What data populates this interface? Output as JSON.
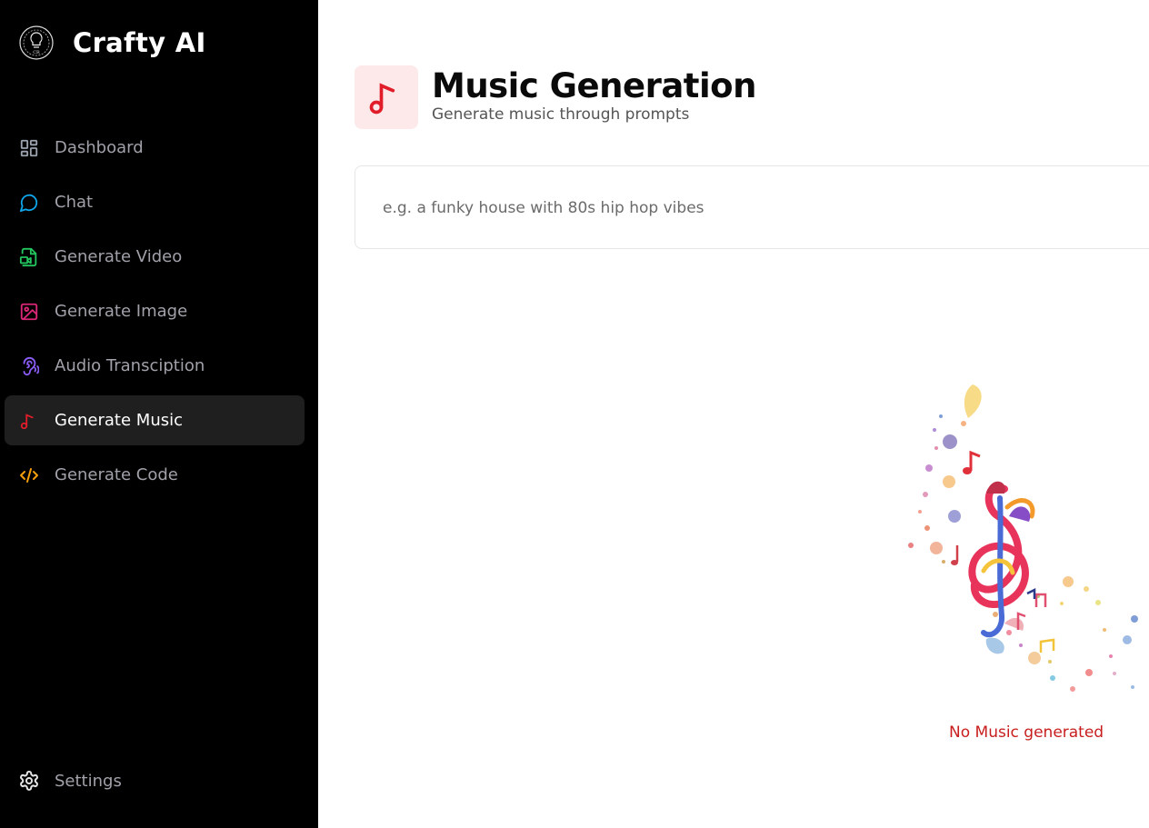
{
  "brand": {
    "name": "Crafty AI",
    "logo_icon": "crafty-ai-logo-icon"
  },
  "sidebar": {
    "items": [
      {
        "label": "Dashboard",
        "icon": "dashboard-icon",
        "color": "#9ca3af",
        "active": false
      },
      {
        "label": "Chat",
        "icon": "chat-bubble-icon",
        "color": "#0ea5e9",
        "active": false
      },
      {
        "label": "Generate Video",
        "icon": "video-file-icon",
        "color": "#22c55e",
        "active": false
      },
      {
        "label": "Generate Image",
        "icon": "image-icon",
        "color": "#db2777",
        "active": false
      },
      {
        "label": "Audio Transciption",
        "icon": "audio-waves-icon",
        "color": "#8b5cf6",
        "active": false
      },
      {
        "label": "Generate Music",
        "icon": "music-note-icon",
        "color": "#e11d2a",
        "active": true
      },
      {
        "label": "Generate Code",
        "icon": "code-icon",
        "color": "#f59e0b",
        "active": false
      }
    ],
    "settings": {
      "label": "Settings",
      "icon": "gear-icon"
    }
  },
  "header": {
    "title": "Music Generation",
    "subtitle": "Generate music through prompts",
    "icon": "music-note-icon",
    "accent": "#e11d2a",
    "icon_bg": "#fde8ea"
  },
  "prompt": {
    "placeholder": "e.g. a funky house with 80s hip hop vibes",
    "value": ""
  },
  "empty_state": {
    "message": "No Music generated",
    "illustration": "colorful-treble-clef-notes-illustration",
    "color": "#c81e1e"
  }
}
